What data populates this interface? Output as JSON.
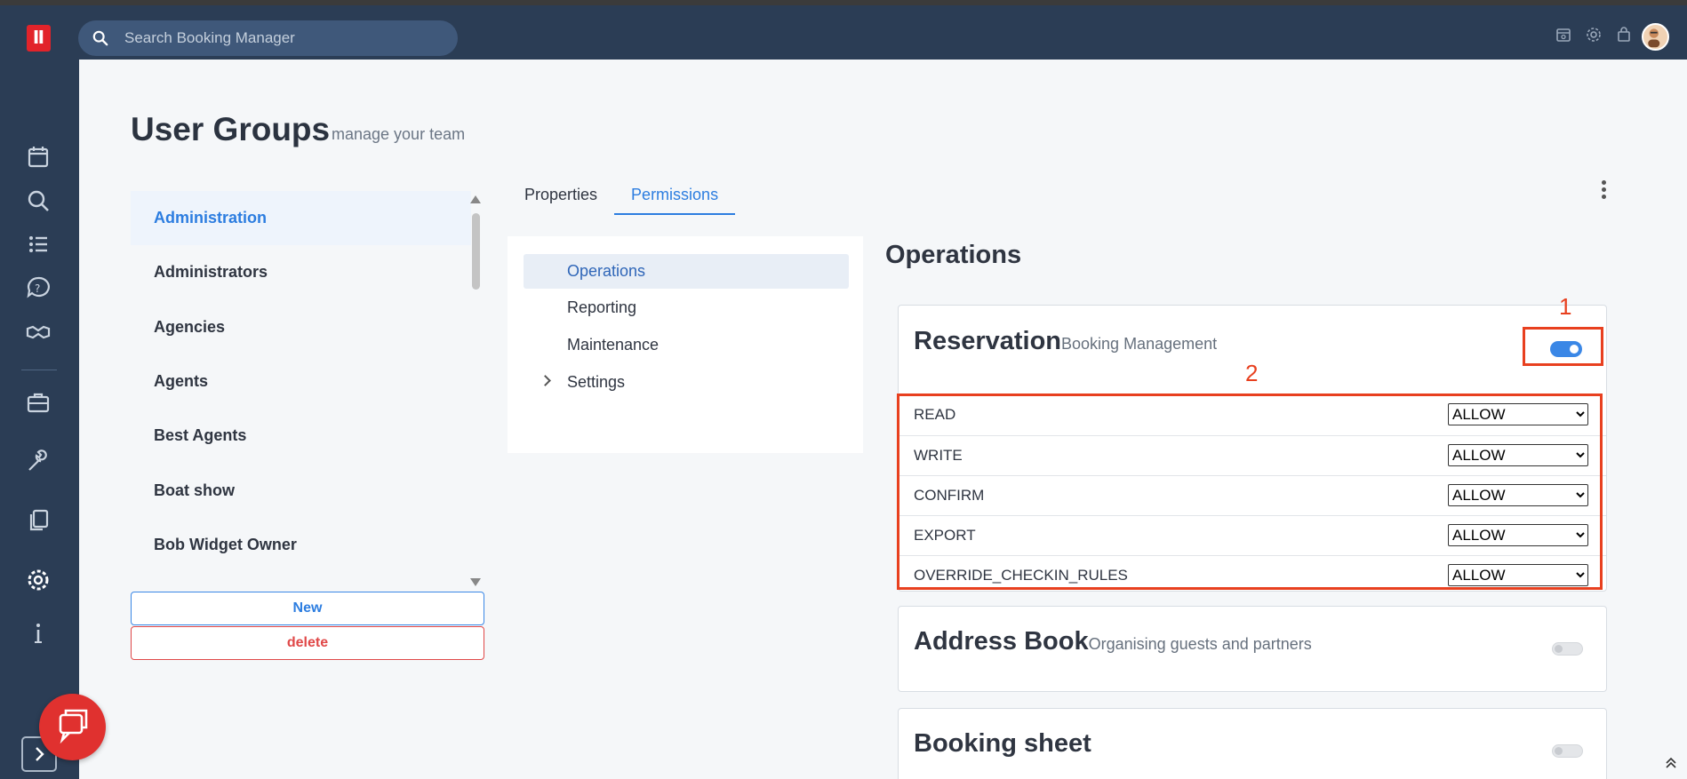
{
  "app": {
    "search_placeholder": "Search Booking Manager",
    "logo_text": "Ⅱ"
  },
  "page": {
    "title": "User Groups",
    "subtitle": "manage your team"
  },
  "groups": [
    {
      "label": "Administration",
      "active": true
    },
    {
      "label": "Administrators"
    },
    {
      "label": "Agencies"
    },
    {
      "label": "Agents"
    },
    {
      "label": "Best Agents"
    },
    {
      "label": "Boat show"
    },
    {
      "label": "Bob Widget Owner"
    }
  ],
  "buttons": {
    "new": "New",
    "delete": "delete"
  },
  "tabs": [
    {
      "label": "Properties"
    },
    {
      "label": "Permissions",
      "active": true
    }
  ],
  "categories": [
    {
      "label": "Operations",
      "active": true
    },
    {
      "label": "Reporting"
    },
    {
      "label": "Maintenance"
    },
    {
      "label": "Settings",
      "expandable": true
    }
  ],
  "section": {
    "title": "Operations"
  },
  "cards": [
    {
      "title": "Reservation",
      "desc": "Booking Management",
      "enabled": true,
      "permissions": [
        {
          "name": "READ",
          "value": "ALLOW"
        },
        {
          "name": "WRITE",
          "value": "ALLOW"
        },
        {
          "name": "CONFIRM",
          "value": "ALLOW"
        },
        {
          "name": "EXPORT",
          "value": "ALLOW"
        },
        {
          "name": "OVERRIDE_CHECKIN_RULES",
          "value": "ALLOW"
        }
      ]
    },
    {
      "title": "Address Book",
      "desc": "Organising guests and partners",
      "enabled": false
    },
    {
      "title": "Booking sheet",
      "desc": "",
      "enabled": false
    }
  ],
  "annotations": {
    "one": "1",
    "two": "2"
  },
  "colors": {
    "accent": "#2c7de0",
    "navy": "#2b3d55",
    "danger": "#e04848",
    "annotation": "#e8401f"
  }
}
